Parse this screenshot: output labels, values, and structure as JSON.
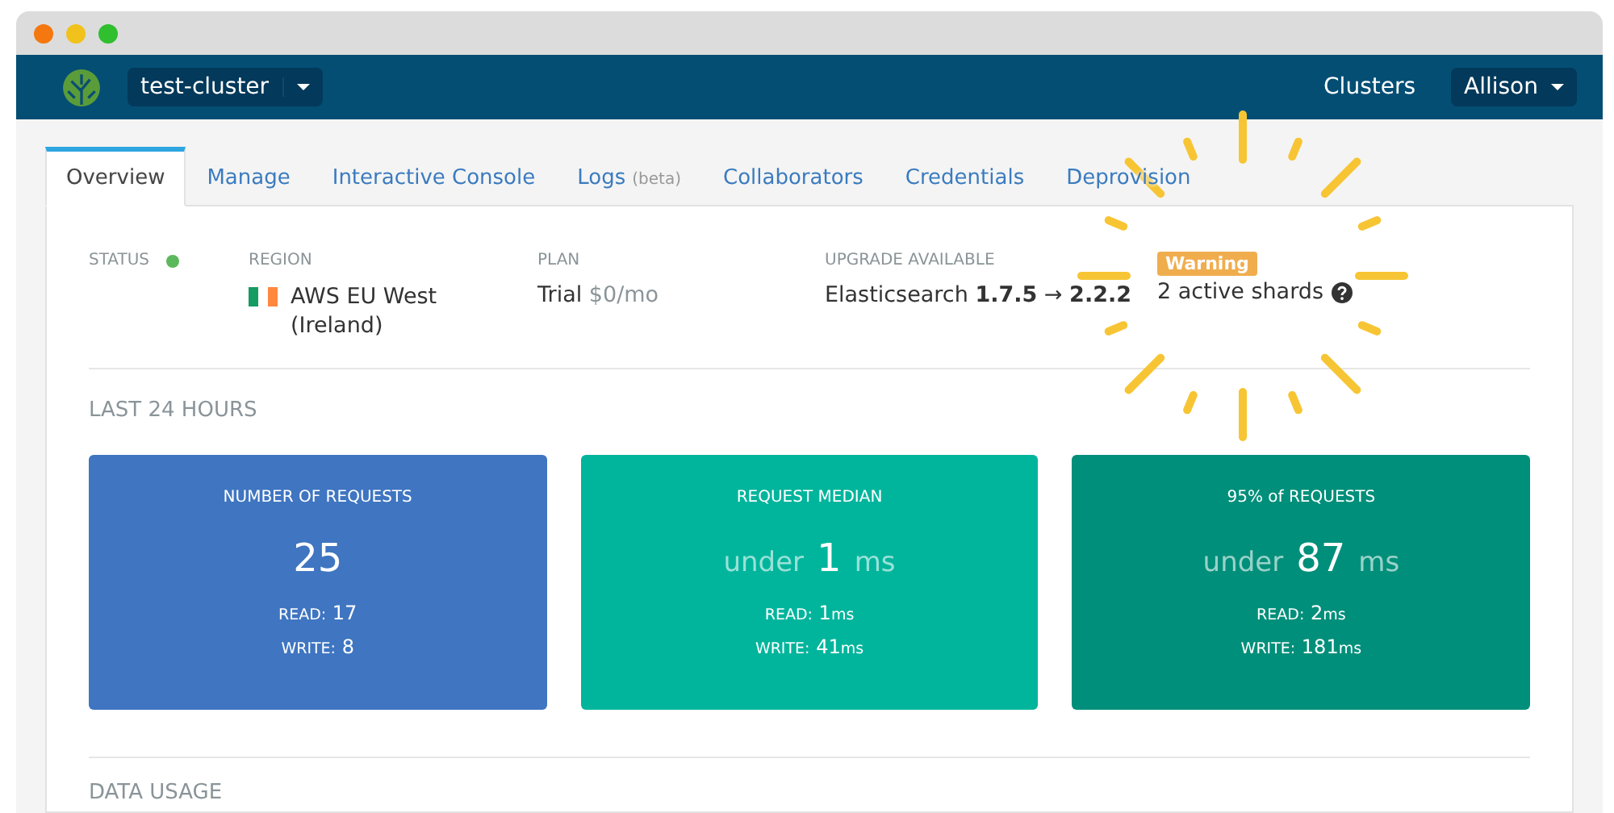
{
  "navbar": {
    "cluster": "test-cluster",
    "links": [
      "Clusters"
    ],
    "user": "Allison"
  },
  "tabs": [
    {
      "label": "Overview",
      "selected": true
    },
    {
      "label": "Manage",
      "selected": false
    },
    {
      "label": "Interactive Console",
      "selected": false
    },
    {
      "label": "Logs",
      "note": "(beta)",
      "selected": false
    },
    {
      "label": "Collaborators",
      "selected": false
    },
    {
      "label": "Credentials",
      "selected": false
    },
    {
      "label": "Deprovision",
      "selected": false
    }
  ],
  "summary": {
    "status": {
      "label": "STATUS",
      "color": "#5cb85c"
    },
    "region": {
      "label": "REGION",
      "value": "AWS EU West (Ireland)"
    },
    "plan": {
      "label": "PLAN",
      "value": "Trial",
      "price": "$0/mo"
    },
    "upgrade": {
      "label": "UPGRADE AVAILABLE",
      "value": "Elasticsearch **1.7.5** → **2.2.2**"
    },
    "warning": {
      "badge": "Warning",
      "text": "2 active shards"
    }
  },
  "section_title": "LAST 24 HOURS",
  "cards": [
    {
      "title": "NUMBER OF REQUESTS",
      "color": "#3f75c1",
      "value": "25",
      "read_label": "READ:",
      "read": "17",
      "write_label": "WRITE:",
      "write": "8"
    },
    {
      "title": "REQUEST MEDIAN",
      "color": "#00b59c",
      "prefix": "under",
      "value": "1",
      "unit": "ms",
      "read_label": "READ:",
      "read": "1",
      "read_unit": "ms",
      "write_label": "WRITE:",
      "write": "41",
      "write_unit": "ms"
    },
    {
      "title": "95% of REQUESTS",
      "color": "#008f7a",
      "prefix": "under",
      "value": "87",
      "unit": "ms",
      "read_label": "READ:",
      "read": "2",
      "read_unit": "ms",
      "write_label": "WRITE:",
      "write": "181",
      "write_unit": "ms"
    }
  ],
  "next_section_title": "DATA USAGE"
}
